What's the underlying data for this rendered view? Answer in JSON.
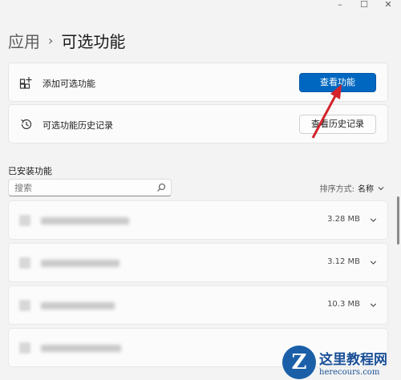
{
  "breadcrumb": {
    "parent": "应用",
    "separator": "›",
    "current": "可选功能"
  },
  "cards": {
    "add": {
      "label": "添加可选功能",
      "button": "查看功能"
    },
    "history": {
      "label": "可选功能历史记录",
      "button": "查看历史记录"
    }
  },
  "installed": {
    "title": "已安装功能",
    "search_placeholder": "搜索",
    "sort_label": "排序方式:",
    "sort_value": "名称",
    "items": [
      {
        "size": "3.28 MB"
      },
      {
        "size": "3.12 MB"
      },
      {
        "size": "10.3 MB"
      },
      {
        "size": ""
      }
    ]
  },
  "watermark": {
    "logo": "Z",
    "title": "这里教程网",
    "url": "herecours.com"
  },
  "colors": {
    "accent": "#0067c0",
    "annotation_arrow": "#d3232b"
  },
  "icons": {
    "add": "add-feature-icon",
    "history": "history-icon",
    "search": "search-icon",
    "chevron": "chevron-down-icon"
  }
}
